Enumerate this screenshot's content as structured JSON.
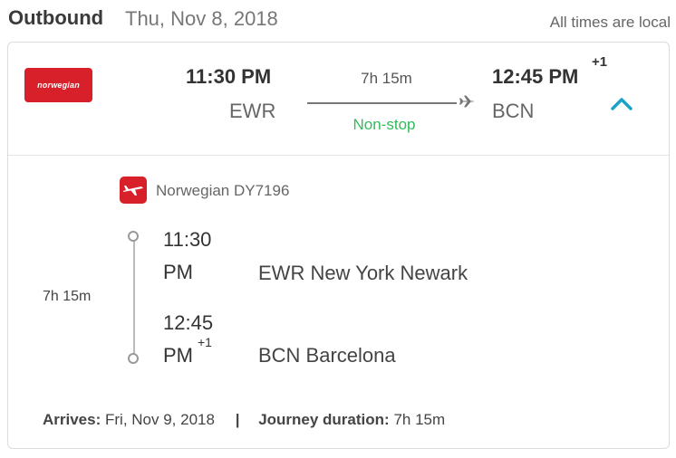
{
  "header": {
    "title": "Outbound",
    "date": "Thu, Nov 8, 2018",
    "times_note": "All times are local"
  },
  "summary": {
    "airline_logo_text": "norwegian",
    "departure": {
      "time": "11:30 PM",
      "code": "EWR"
    },
    "arrival": {
      "time": "12:45 PM",
      "day_offset": "+1",
      "code": "BCN"
    },
    "duration": "7h 15m",
    "stops": "Non-stop",
    "stops_color": "#2ebd59",
    "expand_icon": "chevron-up-icon",
    "accent_color": "#1aa3c8"
  },
  "details": {
    "airline": "Norwegian DY7196",
    "airline_icon": "plane-icon",
    "brand_color": "#d8202a",
    "segment_duration": "7h 15m",
    "departure": {
      "time": "11:30 PM",
      "airport": "EWR New York Newark"
    },
    "arrival": {
      "time": "12:45 PM",
      "day_offset": "+1",
      "airport": "BCN Barcelona"
    }
  },
  "footer": {
    "arrives_label": "Arrives:",
    "arrives_value": "Fri, Nov 9, 2018",
    "separator": "|",
    "journey_label": "Journey duration:",
    "journey_value": "7h 15m"
  }
}
